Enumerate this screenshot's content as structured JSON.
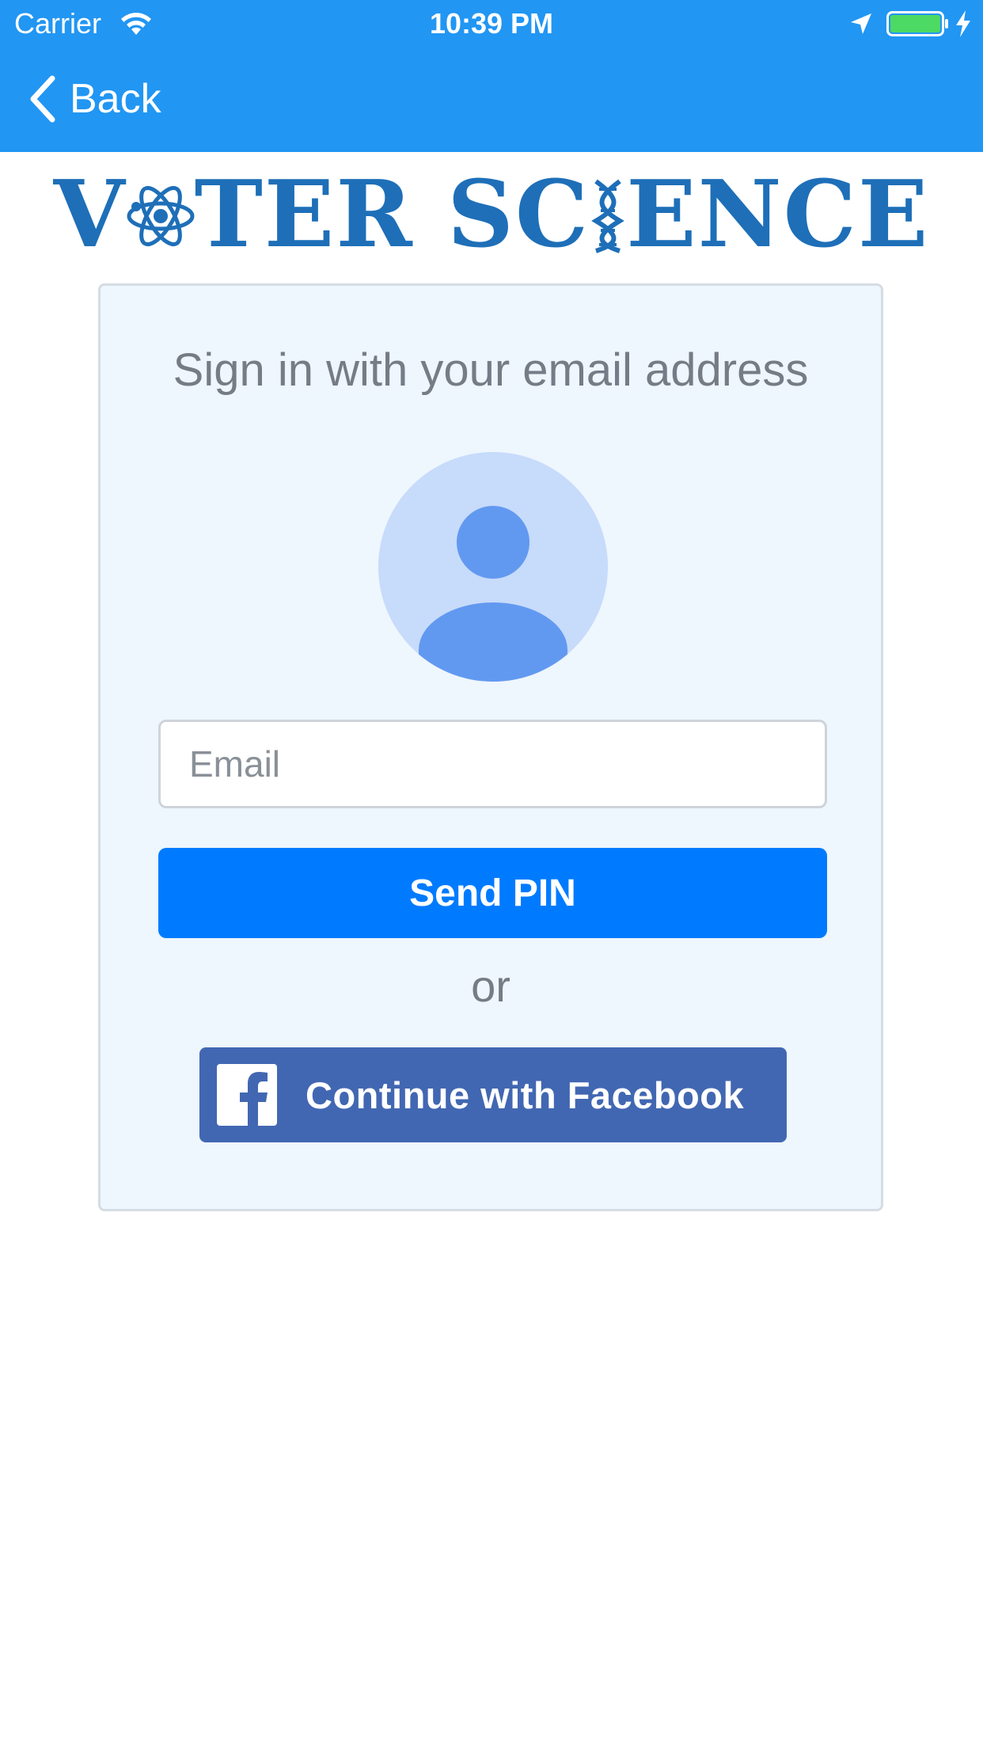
{
  "status_bar": {
    "carrier": "Carrier",
    "time": "10:39 PM",
    "icons": [
      "wifi-icon",
      "location-arrow-icon",
      "battery-icon",
      "charging-bolt-icon"
    ]
  },
  "nav": {
    "back_label": "Back",
    "back_icon": "chevron-left-icon"
  },
  "logo": {
    "part1": "V",
    "part2": "TER SC",
    "part3": "ENCE",
    "color": "#1E6FB8"
  },
  "card": {
    "title": "Sign in with your email address",
    "avatar_icon": "person-placeholder-icon",
    "email_placeholder": "Email",
    "email_value": "",
    "send_pin_label": "Send PIN",
    "or_text": "or",
    "facebook_label": "Continue with Facebook",
    "facebook_icon": "facebook-f-icon"
  },
  "colors": {
    "header": "#2196F3",
    "card_background": "#EEF6FE",
    "primary_button": "#007BFF",
    "facebook": "#4267B2",
    "avatar_background": "#C7DBFB",
    "avatar_figure": "#6299F0",
    "muted_text": "#757C86"
  }
}
